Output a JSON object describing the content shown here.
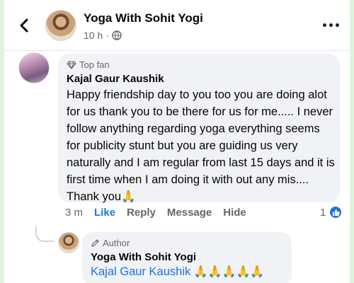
{
  "header": {
    "title": "Yoga With Sohit Yogi",
    "time": "10 h",
    "separator": "·",
    "privacy_icon": "globe-icon"
  },
  "comment": {
    "badge": "Top fan",
    "author": "Kajal Gaur Kaushik",
    "text": "Happy friendship day to you too you are doing alot for us thank you to be there for us for me..... I never follow anything regarding yoga everything seems for publicity stunt but you are guiding us very naturally and I am regular from last 15 days and it is first time when I am doing it with out any mis.... Thank you🙏",
    "time": "3 m",
    "like": "Like",
    "reply": "Reply",
    "message": "Message",
    "hide": "Hide",
    "reaction_count": "1"
  },
  "reply": {
    "badge": "Author",
    "author": "Yoga With Sohit Yogi",
    "mention": "Kajal Gaur Kaushik",
    "emojis": " 🙏🙏🙏🙏🙏"
  },
  "colors": {
    "accent": "#1b74e4",
    "bubble": "#f0f2f5",
    "muted": "#65676b",
    "border_bg": "#dff3df"
  }
}
